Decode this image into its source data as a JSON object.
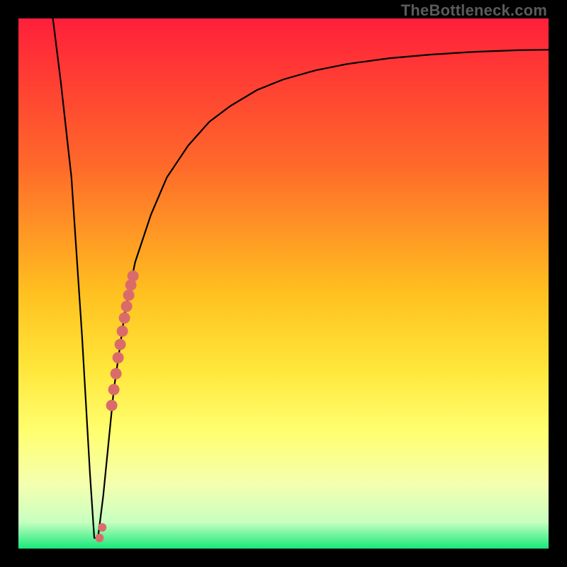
{
  "watermark_text": "TheBottleneck.com",
  "colors": {
    "gradient_top": "#ff1f3a",
    "gradient_25": "#ff6a2a",
    "gradient_50": "#ffc11f",
    "gradient_65": "#ffe63a",
    "gradient_75": "#ffff70",
    "gradient_85": "#f4ffb0",
    "gradient_92": "#c8ffc0",
    "gradient_bottom": "#17e87a",
    "curve": "#000000",
    "marker": "#db6b6b"
  },
  "chart_data": {
    "type": "line",
    "title": "",
    "xlabel": "",
    "ylabel": "",
    "xlim": [
      0,
      100
    ],
    "ylim": [
      0,
      100
    ],
    "series": [
      {
        "name": "bottleneck-curve",
        "x": [
          6.5,
          8,
          10,
          12,
          13.5,
          14.3,
          15,
          16,
          18,
          20,
          22,
          25,
          28,
          32,
          36,
          40,
          45,
          50,
          56,
          62,
          70,
          78,
          86,
          94,
          100
        ],
        "y": [
          100,
          88,
          70,
          40,
          14,
          2,
          2,
          10,
          30,
          44,
          54,
          63,
          70,
          76,
          80.5,
          83.5,
          86.5,
          88.5,
          90.2,
          91.4,
          92.5,
          93.2,
          93.7,
          94.0,
          94.1
        ]
      }
    ],
    "markers": {
      "name": "highlight-segment",
      "x": [
        17.6,
        18.0,
        18.4,
        18.8,
        19.2,
        19.6,
        20.0,
        20.4,
        20.8,
        21.2,
        21.6,
        15.8,
        15.3
      ],
      "y": [
        27.0,
        30.0,
        33.0,
        36.0,
        38.5,
        41.0,
        43.5,
        45.7,
        47.8,
        49.7,
        51.4,
        4.0,
        2.0
      ],
      "radius_primary": 8,
      "radius_tail": 6
    }
  }
}
